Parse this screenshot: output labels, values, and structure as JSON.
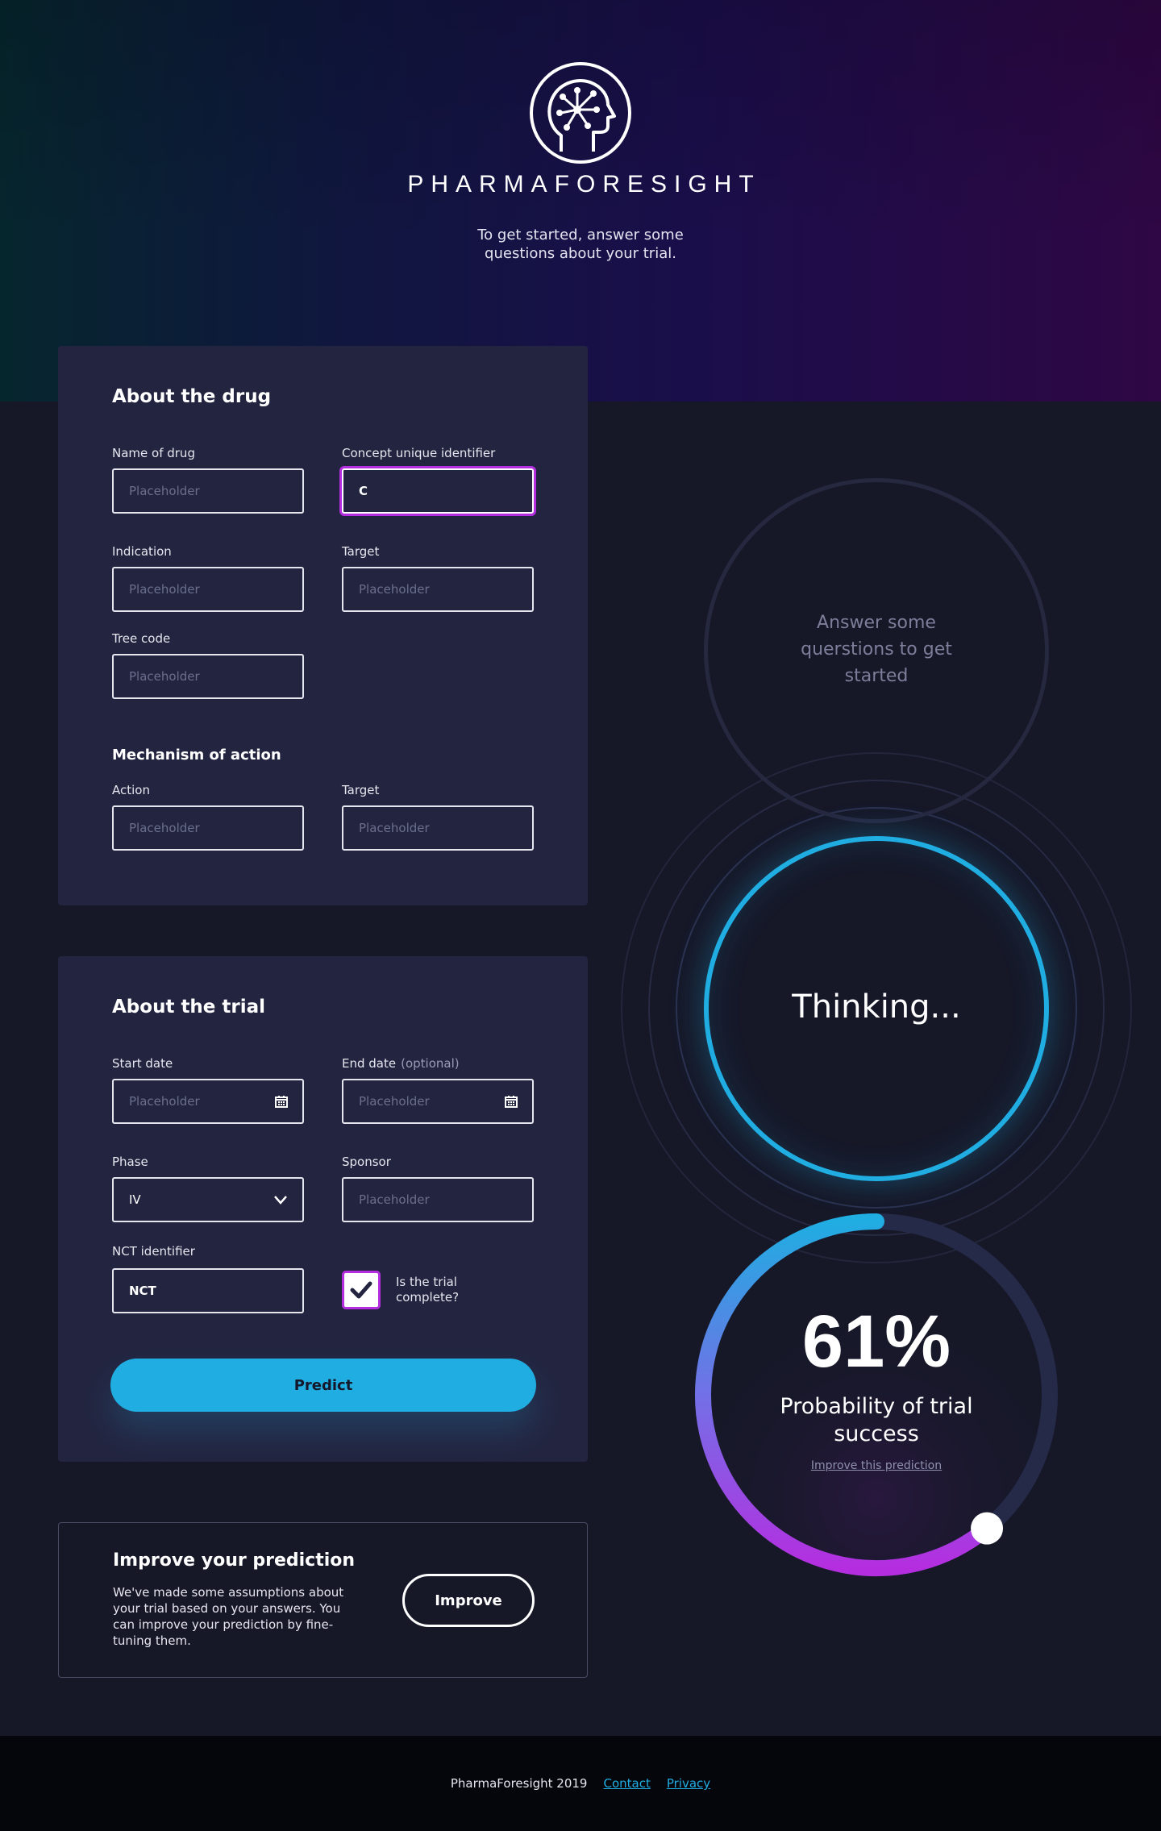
{
  "brand": {
    "name": "PHARMAFORESIGHT",
    "logo_icon": "head-network-icon",
    "tagline": "To get started, answer some questions about your trial."
  },
  "drug_card": {
    "title": "About the drug",
    "fields": {
      "name": {
        "label": "Name of drug",
        "placeholder": "Placeholder",
        "value": ""
      },
      "cui": {
        "label": "Concept unique identifier",
        "placeholder": "Placeholder",
        "value": "C"
      },
      "indication": {
        "label": "Indication",
        "placeholder": "Placeholder",
        "value": ""
      },
      "target": {
        "label": "Target",
        "placeholder": "Placeholder",
        "value": ""
      },
      "tree_code": {
        "label": "Tree code",
        "placeholder": "Placeholder",
        "value": ""
      }
    },
    "moa": {
      "title": "Mechanism of action",
      "action": {
        "label": "Action",
        "placeholder": "Placeholder"
      },
      "target": {
        "label": "Target",
        "placeholder": "Placeholder"
      }
    }
  },
  "trial_card": {
    "title": "About the trial",
    "start_date": {
      "label": "Start date",
      "placeholder": "Placeholder",
      "icon": "calendar-icon"
    },
    "end_date": {
      "label": "End date",
      "optional": "(optional)",
      "placeholder": "Placeholder",
      "icon": "calendar-icon"
    },
    "phase": {
      "label": "Phase",
      "value": "IV",
      "icon": "chevron-down-icon"
    },
    "sponsor": {
      "label": "Sponsor",
      "placeholder": "Placeholder"
    },
    "nct": {
      "label": "NCT identifier",
      "value": "NCT"
    },
    "complete": {
      "label": "Is the trial complete?",
      "checked": true
    },
    "predict_label": "Predict"
  },
  "improve_card": {
    "title": "Improve your prediction",
    "text": "We've made some assumptions about your trial based on your answers. You can improve your prediction by fine-tuning them.",
    "button_label": "Improve"
  },
  "states": {
    "empty_text": "Answer some querstions to get started",
    "thinking_text": "Thinking...",
    "result": {
      "percent": "61%",
      "probability": 0.61,
      "label": "Probability of trial success",
      "link": "Improve this prediction"
    }
  },
  "colors": {
    "accent_blue": "#20ade2",
    "accent_purple": "#b42ee0",
    "card_bg": "#232540",
    "page_bg": "#161828"
  },
  "footer": {
    "copyright": "PharmaForesight 2019",
    "contact": "Contact",
    "privacy": "Privacy"
  }
}
